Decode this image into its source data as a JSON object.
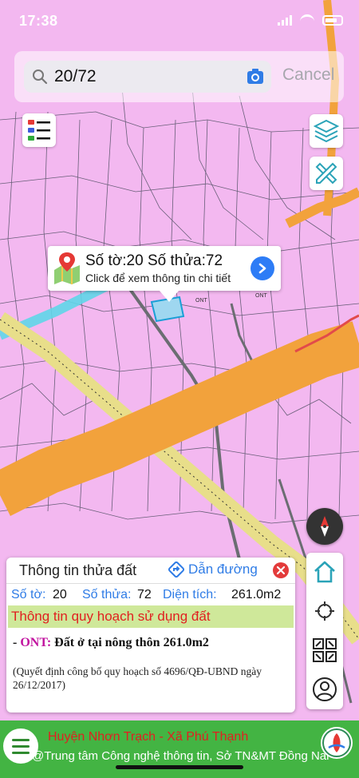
{
  "status_bar": {
    "time": "17:38"
  },
  "search": {
    "value": "20/72",
    "cancel_label": "Cancel"
  },
  "popup": {
    "title": "Số tờ:20 Số thửa:72",
    "subtitle": "Click để xem thông tin chi tiết"
  },
  "map_labels": {
    "label_1": "ONT",
    "label_2": "ONT"
  },
  "info_panel": {
    "title": "Thông tin thửa đất",
    "route_label": "Dẫn đường",
    "sheet_label": "Số tờ:",
    "sheet_value": "20",
    "parcel_label": "Số thửa:",
    "parcel_value": "72",
    "area_label": "Diện tích:",
    "area_value": "261.0m2",
    "plan_header": "Thông tin quy hoạch sử dụng đất",
    "plan_prefix": "- ",
    "plan_code": "ONT:",
    "plan_desc": " Đất ở tại nông thôn 261.0m2",
    "plan_note": "(Quyết định công bố quy hoạch số 4696/QĐ-UBND ngày 26/12/2017)"
  },
  "bottom_bar": {
    "location": "Huyện Nhơn Trạch - Xã Phú Thạnh",
    "organization": "@Trung tâm Công nghệ thông tin, Sở TN&MT Đồng Nai"
  },
  "colors": {
    "map_bg": "#f3b8f0",
    "road": "#f2a23c",
    "accent_blue": "#2f7ce6",
    "plan_green": "#cfe89a",
    "bar_green": "#43b443",
    "alert_red": "#e02020"
  }
}
